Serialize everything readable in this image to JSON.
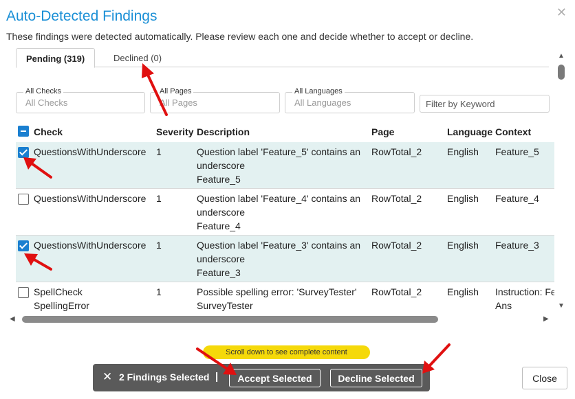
{
  "dialog": {
    "title": "Auto-Detected Findings",
    "subtitle": "These findings were detected automatically. Please review each one and decide whether to accept or decline.",
    "close_icon": "close-icon"
  },
  "tabs": [
    {
      "label": "Pending (319)",
      "active": true
    },
    {
      "label": "Declined (0)",
      "active": false
    }
  ],
  "filters": {
    "checks": {
      "label": "All Checks",
      "value": "All Checks"
    },
    "pages": {
      "label": "All Pages",
      "value": "All Pages"
    },
    "languages": {
      "label": "All Languages",
      "value": "All Languages"
    },
    "keyword_placeholder": "Filter by Keyword"
  },
  "table": {
    "columns": [
      "Check",
      "Severity",
      "Description",
      "Page",
      "Language",
      "Context"
    ],
    "rows": [
      {
        "checked": true,
        "check": [
          "QuestionsWithUnderscore"
        ],
        "severity": "1",
        "description": [
          "Question label 'Feature_5' contains an",
          "underscore",
          "Feature_5"
        ],
        "page": "RowTotal_2",
        "language": "English",
        "context": [
          "Feature_5"
        ]
      },
      {
        "checked": false,
        "check": [
          "QuestionsWithUnderscore"
        ],
        "severity": "1",
        "description": [
          "Question label 'Feature_4' contains an",
          "underscore",
          "Feature_4"
        ],
        "page": "RowTotal_2",
        "language": "English",
        "context": [
          "Feature_4"
        ]
      },
      {
        "checked": true,
        "check": [
          "QuestionsWithUnderscore"
        ],
        "severity": "1",
        "description": [
          "Question label 'Feature_3' contains an",
          "underscore",
          "Feature_3"
        ],
        "page": "RowTotal_2",
        "language": "English",
        "context": [
          "Feature_3"
        ]
      },
      {
        "checked": false,
        "check": [
          "SpellCheck",
          "SpellingError"
        ],
        "severity": "1",
        "description": [
          "Possible spelling error: 'SurveyTester'",
          "SurveyTester"
        ],
        "page": "RowTotal_2",
        "language": "English",
        "context": [
          "Instruction: Fe",
          "Ans"
        ]
      }
    ]
  },
  "hint": "Scroll down to see complete content",
  "action_bar": {
    "selected_count": "2 Findings Selected",
    "separator": "|",
    "accept_label": "Accept Selected",
    "decline_label": "Decline Selected"
  },
  "close_label": "Close",
  "colors": {
    "accent": "#1a8fd6",
    "selected_row": "#e3f1f1",
    "hint": "#f5d90a",
    "arrow": "#e01010"
  }
}
